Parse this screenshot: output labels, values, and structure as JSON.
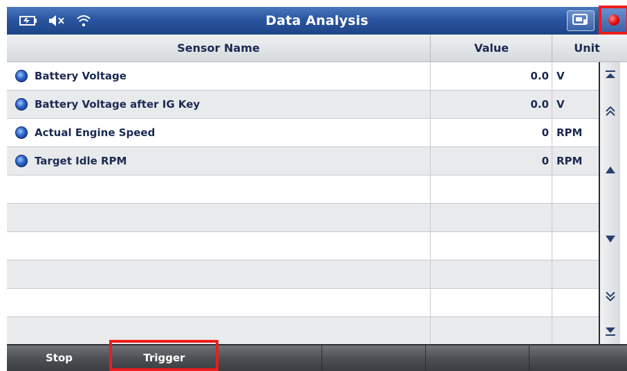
{
  "header": {
    "title": "Data Analysis"
  },
  "status_icons": [
    "battery-icon",
    "speaker-mute-icon",
    "wifi-icon"
  ],
  "toolbar_icons": [
    "camera-icon",
    "record-icon"
  ],
  "table": {
    "columns": [
      "Sensor Name",
      "Value",
      "Unit"
    ],
    "rows": [
      {
        "name": "Battery Voltage",
        "value": "0.0",
        "unit": "V"
      },
      {
        "name": "Battery Voltage after IG Key",
        "value": "0.0",
        "unit": "V"
      },
      {
        "name": "Actual Engine Speed",
        "value": "0",
        "unit": "RPM"
      },
      {
        "name": "Target Idle RPM",
        "value": "0",
        "unit": "RPM"
      }
    ],
    "empty_rows": 6
  },
  "scroll_buttons": [
    "scroll-top-icon",
    "page-up-icon",
    "arrow-up-icon",
    "arrow-down-icon",
    "page-down-icon",
    "scroll-bottom-icon"
  ],
  "bottom_buttons": [
    "Stop",
    "Trigger",
    "",
    "",
    "",
    ""
  ],
  "colors": {
    "title_bar": "#2a56a0",
    "highlight": "#ee1c1c",
    "text": "#1b2a52"
  }
}
